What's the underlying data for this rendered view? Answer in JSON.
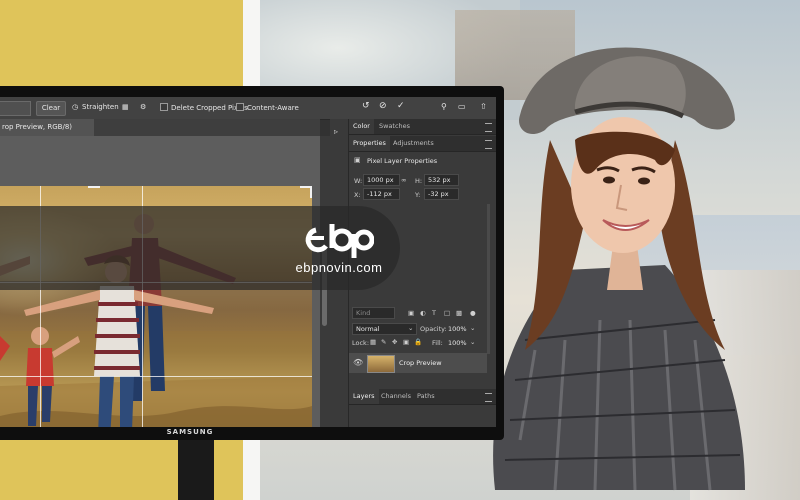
{
  "toolbar": {
    "clear_label": "Clear",
    "straighten_label": "Straighten",
    "delete_cropped_label": "Delete Cropped Pixels",
    "content_aware_label": "Content-Aware"
  },
  "document": {
    "tab_title": "rop Preview, RGB/8)"
  },
  "panels": {
    "top_tabs": [
      "Color",
      "Swatches"
    ],
    "props_tabs": [
      "Properties",
      "Adjustments"
    ],
    "props_title": "Pixel Layer Properties",
    "w_label": "W:",
    "w_value": "1000 px",
    "h_label": "H:",
    "h_value": "532 px",
    "x_label": "X:",
    "x_value": "-112 px",
    "y_label": "Y:",
    "y_value": "-32 px",
    "layer_tabs": [
      "Layers",
      "Channels",
      "Paths"
    ],
    "kind_placeholder": "Kind",
    "blend_mode": "Normal",
    "opacity_label": "Opacity:",
    "opacity_value": "100%",
    "lock_label": "Lock:",
    "fill_label": "Fill:",
    "fill_value": "100%",
    "layer_name": "Crop Preview"
  },
  "monitor": {
    "brand": "SAMSUNG"
  },
  "watermark": {
    "text": "ebpnovin.com"
  }
}
